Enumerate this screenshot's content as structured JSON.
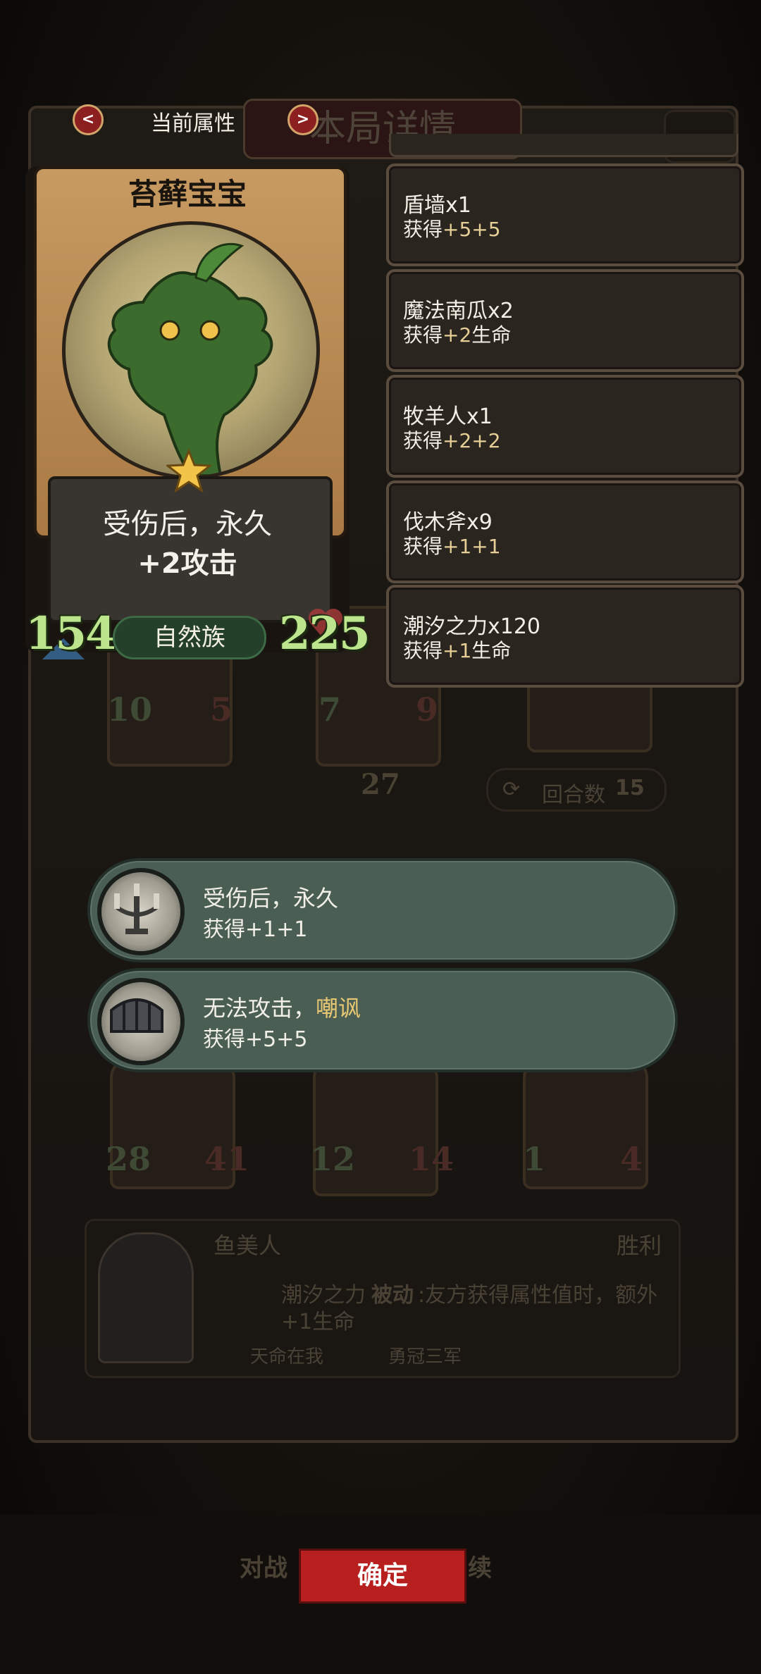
{
  "nav": {
    "prev_arrow": "<",
    "next_arrow": ">",
    "current_attributes_label": "当前属性",
    "panel_title": "本局详情"
  },
  "card": {
    "name": "苔藓宝宝",
    "description_line1": "受伤后，永久",
    "description_line2": "+2攻击",
    "attack": "154",
    "health": "225",
    "tribe": "自然族"
  },
  "gains": [
    {
      "name": "盾墙x1",
      "prefix": "获得",
      "value": "+5+5",
      "suffix": ""
    },
    {
      "name": "魔法南瓜x2",
      "prefix": "获得",
      "value": "+2",
      "suffix": "生命"
    },
    {
      "name": "牧羊人x1",
      "prefix": "获得",
      "value": "+2+2",
      "suffix": ""
    },
    {
      "name": "伐木斧x9",
      "prefix": "获得",
      "value": "+1+1",
      "suffix": ""
    },
    {
      "name": "潮汐之力x120",
      "prefix": "获得",
      "value": "+1",
      "suffix": "生命"
    }
  ],
  "effects": [
    {
      "line1_a": "受伤后，永久",
      "line1_b": "",
      "line2": "获得+1+1",
      "icon": "candelabra-icon"
    },
    {
      "line1_a": "无法攻击，",
      "line1_b": "嘲讽",
      "line2": "获得+5+5",
      "icon": "shield-wall-icon"
    }
  ],
  "background": {
    "round_label": "回合数",
    "round_number": "15",
    "center_badge": "27",
    "unit_stats": [
      {
        "atk": "10",
        "hp": "5"
      },
      {
        "atk": "7",
        "hp": "9"
      },
      {
        "atk": "28",
        "hp": "41"
      },
      {
        "atk": "12",
        "hp": "14"
      },
      {
        "atk": "1",
        "hp": "4"
      }
    ],
    "opponent_name": "鱼美人",
    "result": "胜利",
    "skill_name": "潮汐之力",
    "skill_type": "被动",
    "skill_desc": ":友方获得属性值时，额外",
    "skill_desc2": "+1生命",
    "tag1": "天命在我",
    "tag2": "勇冠三军",
    "footer_left": "对战",
    "footer_right": "续"
  },
  "confirm_label": "确定",
  "colors": {
    "accent_red": "#b81f1f",
    "stat_green": "#bde58d",
    "effect_teal": "#4a5e54",
    "gold_text": "#e6cf96"
  }
}
